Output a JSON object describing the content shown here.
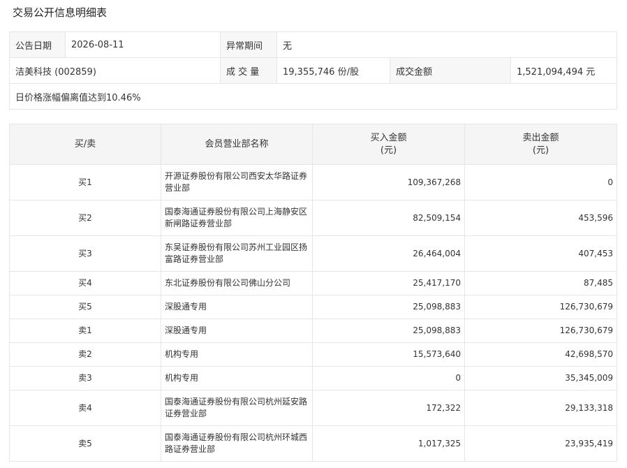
{
  "page_title": "交易公开信息明细表",
  "info": {
    "date_label": "公告日期",
    "date_value": "2026-08-11",
    "abnormal_label": "异常期间",
    "abnormal_value": "无",
    "stock": "洁美科技 (002859)",
    "volume_label": "成 交 量",
    "volume_value": "19,355,746 份/股",
    "amount_label": "成交金额",
    "amount_value": "1,521,094,494 元",
    "reason": "日价格涨幅偏离值达到10.46%"
  },
  "table": {
    "headers": {
      "side": "买/卖",
      "broker": "会员营业部名称",
      "buy_amount": "买入金额",
      "buy_unit": "(元)",
      "sell_amount": "卖出金额",
      "sell_unit": "(元)"
    },
    "rows": [
      {
        "side": "买1",
        "broker": "开源证券股份有限公司西安太华路证券营业部",
        "buy": "109,367,268",
        "sell": "0"
      },
      {
        "side": "买2",
        "broker": "国泰海通证券股份有限公司上海静安区新闸路证券营业部",
        "buy": "82,509,154",
        "sell": "453,596"
      },
      {
        "side": "买3",
        "broker": "东吴证券股份有限公司苏州工业园区扬富路证券营业部",
        "buy": "26,464,004",
        "sell": "407,453"
      },
      {
        "side": "买4",
        "broker": "东北证券股份有限公司佛山分公司",
        "buy": "25,417,170",
        "sell": "87,485"
      },
      {
        "side": "买5",
        "broker": "深股通专用",
        "buy": "25,098,883",
        "sell": "126,730,679"
      },
      {
        "side": "卖1",
        "broker": "深股通专用",
        "buy": "25,098,883",
        "sell": "126,730,679"
      },
      {
        "side": "卖2",
        "broker": "机构专用",
        "buy": "15,573,640",
        "sell": "42,698,570"
      },
      {
        "side": "卖3",
        "broker": "机构专用",
        "buy": "0",
        "sell": "35,345,009"
      },
      {
        "side": "卖4",
        "broker": "国泰海通证券股份有限公司杭州延安路证券营业部",
        "buy": "172,322",
        "sell": "29,133,318"
      },
      {
        "side": "卖5",
        "broker": "国泰海通证券股份有限公司杭州环城西路证券营业部",
        "buy": "1,017,325",
        "sell": "23,935,419"
      }
    ]
  }
}
